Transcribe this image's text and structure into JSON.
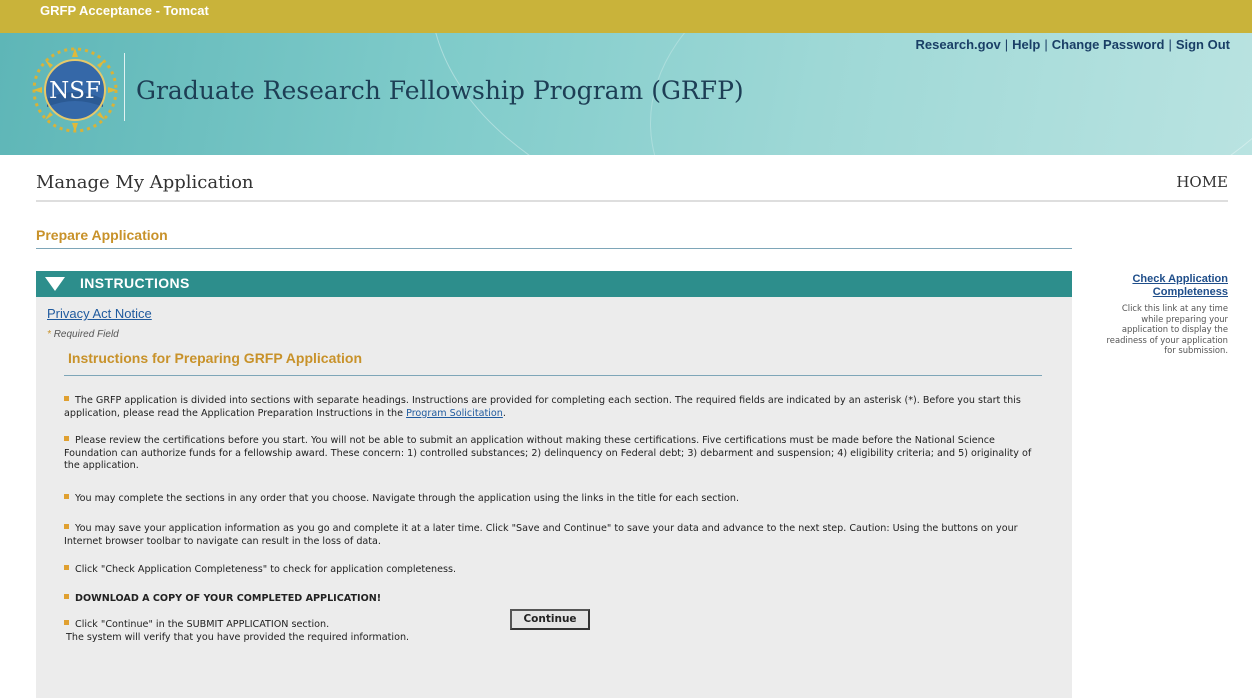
{
  "env_bar": {
    "title": "GRFP Acceptance - Tomcat"
  },
  "header": {
    "links": [
      "Research.gov",
      "Help",
      "Change Password",
      "Sign Out"
    ],
    "logo_text": "NSF",
    "program_title": "Graduate Research Fellowship Program (GRFP)"
  },
  "page": {
    "title": "Manage My Application",
    "home_link": "HOME",
    "section_heading": "Prepare Application"
  },
  "instructions": {
    "bar_label": "INSTRUCTIONS",
    "privacy_link": "Privacy Act Notice",
    "required_marker": "*",
    "required_note": "Required Field",
    "title": "Instructions for Preparing GRFP Application",
    "items": [
      {
        "text_before_link": "The GRFP application is divided into sections with separate headings. Instructions are provided for completing each section. The required fields are indicated by an asterisk (*). Before you start this application, please read the Application Preparation Instructions in the ",
        "link": "Program Solicitation",
        "text_after_link": "."
      },
      {
        "text": "Please review the certifications before you start. You will not be able to submit an application without making these certifications. Five certifications must be made before the National Science Foundation can authorize funds for a fellowship award. These concern: 1) controlled substances; 2) delinquency on Federal debt; 3) debarment and suspension; 4) eligibility criteria; and 5) originality of the application."
      },
      {
        "text": "You may complete the sections in any order that you choose. Navigate through the application using the links in the title for each section."
      },
      {
        "text": "You may save your application information as you go and complete it at a later time. Click \"Save and Continue\" to save your data and advance to the next step. Caution: Using the buttons on your Internet browser toolbar to navigate can result in the loss of data."
      },
      {
        "text": "Click \"Check Application Completeness\" to check for application completeness."
      },
      {
        "text": "DOWNLOAD A COPY OF YOUR COMPLETED APPLICATION!"
      },
      {
        "line1": "Click \"Continue\" in the SUBMIT APPLICATION section.",
        "line2": "The system will verify that you have provided the required information."
      }
    ],
    "continue_button": "Continue"
  },
  "sidebar": {
    "link": "Check Application Completeness",
    "description": "Click this link at any time while preparing your application to display the readiness of your application for submission."
  },
  "colors": {
    "env_bar": "#c9b33a",
    "banner": "#7fcbca",
    "instructions_bar": "#2d8e8c",
    "heading_gold": "#c8922a",
    "link_blue": "#1f5a9e"
  },
  "icons": [
    "nsf-logo-icon",
    "collapse-triangle-icon",
    "bullet-icon"
  ]
}
